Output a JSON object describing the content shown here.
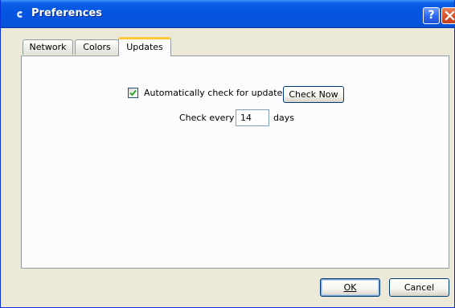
{
  "window": {
    "title": "Preferences",
    "help_glyph": "?",
    "icons": {
      "app": "app-icon",
      "help": "help-icon",
      "close": "close-icon"
    }
  },
  "tabs": [
    {
      "label": "Network",
      "active": false
    },
    {
      "label": "Colors",
      "active": false
    },
    {
      "label": "Updates",
      "active": true
    }
  ],
  "updates": {
    "auto_check_label": "Automatically check for updates",
    "auto_check_checked": true,
    "check_now_label": "Check Now",
    "check_every_label": "Check every",
    "interval_value": "14",
    "interval_unit": "days"
  },
  "footer": {
    "ok_label": "OK",
    "cancel_label": "Cancel"
  },
  "colors": {
    "titlebar": "#0654de",
    "active_tab_accent": "#ffc83c",
    "dialog_face": "#ece9d8"
  }
}
